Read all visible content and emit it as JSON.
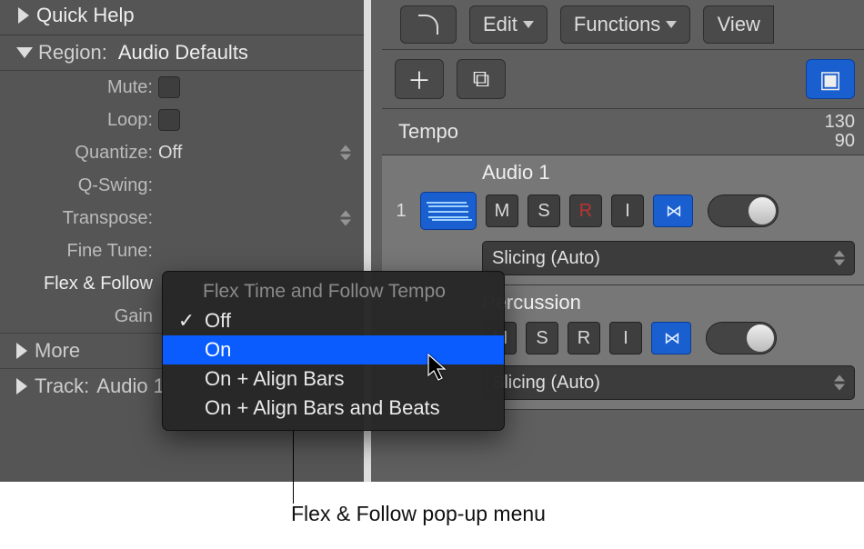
{
  "inspector": {
    "quick_help": "Quick Help",
    "region_label": "Region:",
    "region_value": "Audio Defaults",
    "params": {
      "mute_label": "Mute:",
      "loop_label": "Loop:",
      "quantize_label": "Quantize:",
      "quantize_value": "Off",
      "qswing_label": "Q-Swing:",
      "transpose_label": "Transpose:",
      "finetune_label": "Fine Tune:",
      "flexfollow_label": "Flex & Follow",
      "gain_label": "Gain"
    },
    "more_label": "More",
    "track_label": "Track:",
    "track_value": "Audio 1"
  },
  "toolbar": {
    "edit_label": "Edit",
    "functions_label": "Functions",
    "view_label": "View"
  },
  "tempo": {
    "label": "Tempo",
    "top": "130",
    "bottom": "90"
  },
  "tracks": [
    {
      "number": "1",
      "name": "Audio 1",
      "buttons": {
        "m": "M",
        "s": "S",
        "r": "R",
        "i": "I"
      },
      "mode": "Slicing (Auto)"
    },
    {
      "number": "",
      "name": "Percussion",
      "buttons": {
        "m": "M",
        "s": "S",
        "r": "R",
        "i": "I"
      },
      "mode": "Slicing (Auto)"
    }
  ],
  "popup": {
    "title": "Flex Time and Follow Tempo",
    "items": [
      "Off",
      "On",
      "On + Align Bars",
      "On + Align Bars and Beats"
    ],
    "checked_index": 0,
    "highlight_index": 1
  },
  "annotation": "Flex & Follow pop-up menu"
}
